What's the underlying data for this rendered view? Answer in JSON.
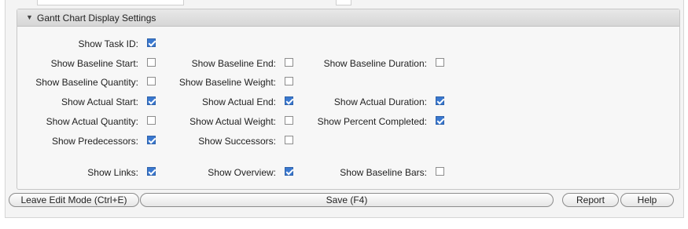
{
  "section": {
    "title": "Gantt Chart Display Settings",
    "expanded": true
  },
  "rows": [
    [
      {
        "label": "Show Task ID:",
        "checked": true
      }
    ],
    [
      {
        "label": "Show Baseline Start:",
        "checked": false
      },
      {
        "label": "Show Baseline End:",
        "checked": false
      },
      {
        "label": "Show Baseline Duration:",
        "checked": false
      }
    ],
    [
      {
        "label": "Show Baseline Quantity:",
        "checked": false
      },
      {
        "label": "Show Baseline Weight:",
        "checked": false
      }
    ],
    [
      {
        "label": "Show Actual Start:",
        "checked": true
      },
      {
        "label": "Show Actual End:",
        "checked": true
      },
      {
        "label": "Show Actual Duration:",
        "checked": true
      }
    ],
    [
      {
        "label": "Show Actual Quantity:",
        "checked": false
      },
      {
        "label": "Show Actual Weight:",
        "checked": false
      },
      {
        "label": "Show Percent Completed:",
        "checked": true
      }
    ],
    [
      {
        "label": "Show Predecessors:",
        "checked": true
      },
      {
        "label": "Show Successors:",
        "checked": false
      }
    ],
    [
      {
        "label": "Show Links:",
        "checked": true
      },
      {
        "label": "Show Overview:",
        "checked": true
      },
      {
        "label": "Show Baseline Bars:",
        "checked": false
      }
    ]
  ],
  "buttons": {
    "leave_edit": "Leave Edit Mode (Ctrl+E)",
    "save": "Save (F4)",
    "report": "Report",
    "help": "Help"
  },
  "colors": {
    "checkbox_checked": "#3a78cf",
    "header_bg": "#dedede"
  }
}
